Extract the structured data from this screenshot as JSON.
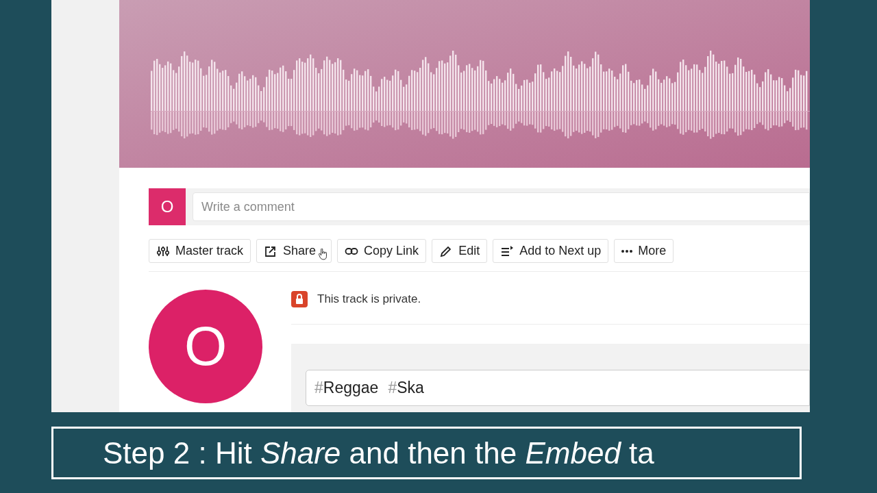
{
  "comment": {
    "avatar_letter": "O",
    "placeholder": "Write a comment"
  },
  "actions": [
    {
      "kind": "mixer",
      "label": "Master track"
    },
    {
      "kind": "share",
      "label": "Share"
    },
    {
      "kind": "link",
      "label": "Copy Link"
    },
    {
      "kind": "edit",
      "label": "Edit"
    },
    {
      "kind": "queue",
      "label": "Add to Next up"
    },
    {
      "kind": "more",
      "label": "More"
    }
  ],
  "privacy_notice": "This track is private.",
  "artist_avatar_letter": "O",
  "tags": [
    "#Reggae",
    "#Ska"
  ],
  "caption": "Step 2 : Hit *Share* and then the *Embed* ta"
}
